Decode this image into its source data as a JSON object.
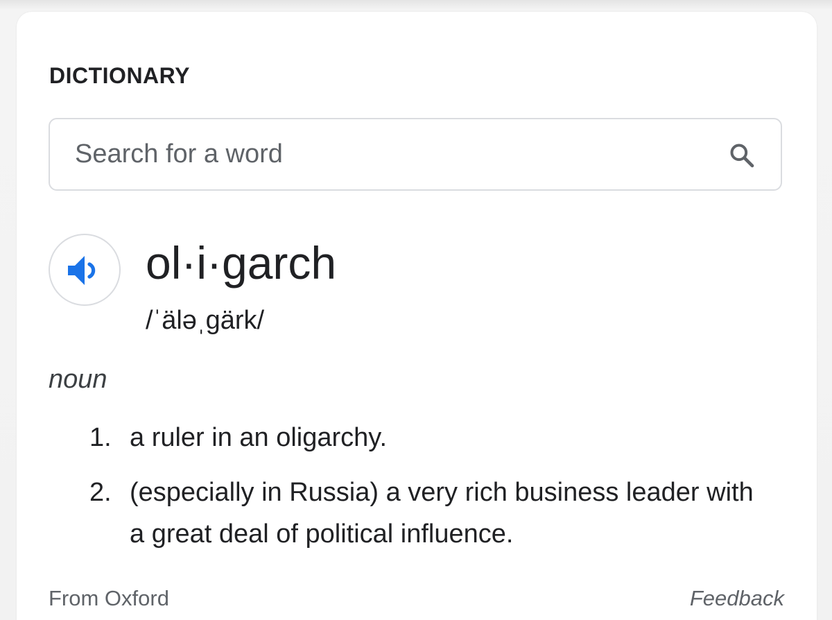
{
  "card": {
    "title": "DICTIONARY"
  },
  "search": {
    "placeholder": "Search for a word",
    "value": "",
    "icon": "search-icon"
  },
  "entry": {
    "audio_icon": "speaker-icon",
    "audio_color": "#1a73e8",
    "headword": "ol·i·garch",
    "pronunciation": "/ˈäləˌgärk/",
    "part_of_speech": "noun",
    "definitions": [
      {
        "number": "1.",
        "text": "a ruler in an oligarchy."
      },
      {
        "number": "2.",
        "text": "(especially in Russia) a very rich business leader with a great deal of political influence."
      }
    ]
  },
  "footer": {
    "source": "From Oxford",
    "feedback": "Feedback"
  }
}
